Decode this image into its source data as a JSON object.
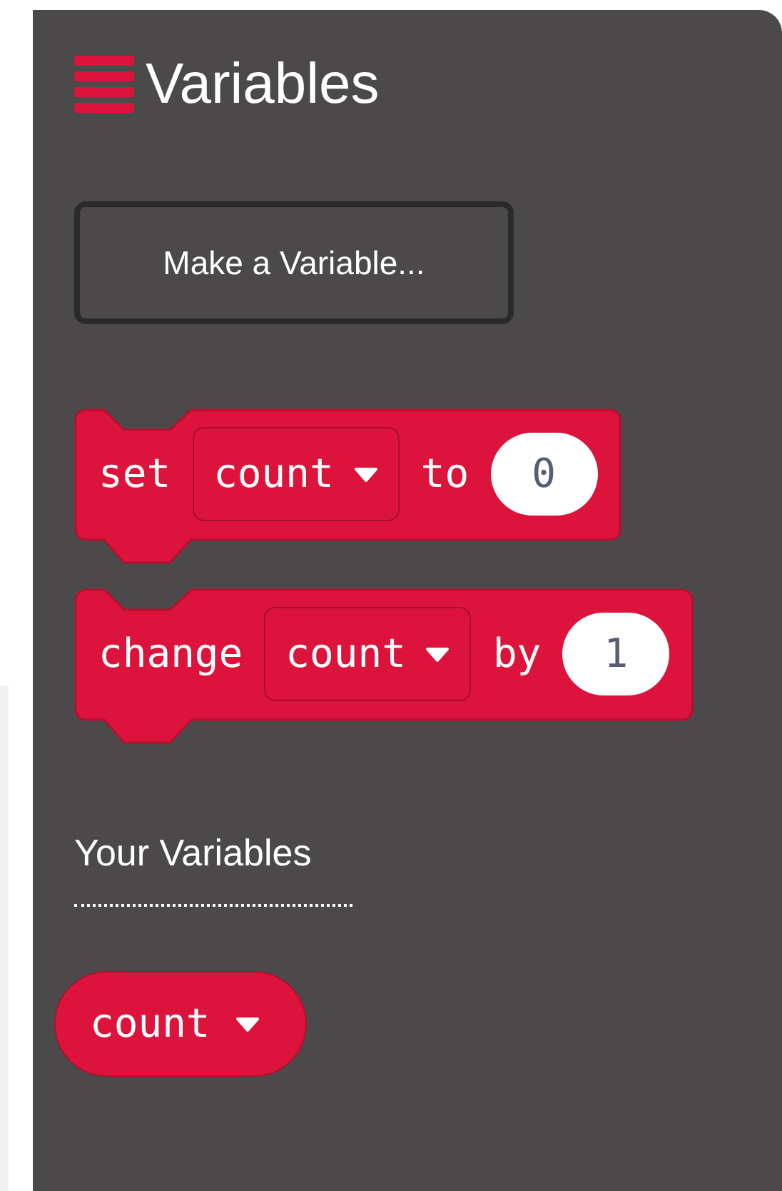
{
  "category": {
    "title": "Variables"
  },
  "make_button": {
    "label": "Make a Variable..."
  },
  "blocks": [
    {
      "parts": [
        {
          "kind": "label",
          "text": "set"
        },
        {
          "kind": "dropdown",
          "text": "count"
        },
        {
          "kind": "label",
          "text": "to"
        },
        {
          "kind": "number",
          "text": "0"
        }
      ]
    },
    {
      "parts": [
        {
          "kind": "label",
          "text": "change"
        },
        {
          "kind": "dropdown",
          "text": "count"
        },
        {
          "kind": "label",
          "text": "by"
        },
        {
          "kind": "number",
          "text": "1"
        }
      ]
    }
  ],
  "section_heading": "Your Variables",
  "variables": [
    {
      "name": "count"
    }
  ]
}
